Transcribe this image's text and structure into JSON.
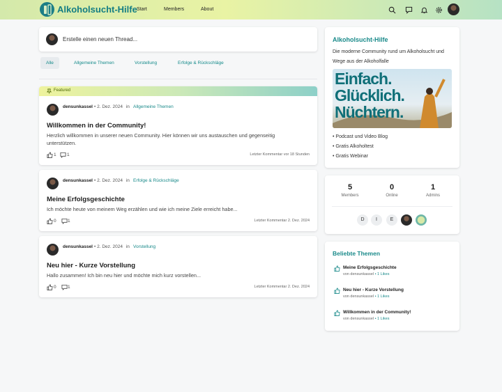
{
  "header": {
    "brand": "Alkoholsucht-Hilfe",
    "nav": [
      "Start",
      "Members",
      "About"
    ],
    "icons": [
      "search-icon",
      "chat-icon",
      "bell-icon",
      "gear-icon",
      "avatar"
    ]
  },
  "composer": {
    "placeholder": "Erstelle einen neuen Thread..."
  },
  "tabs": [
    "Alle",
    "Allgemeine Themen",
    "Vorstellung",
    "Erfolge & Rückschläge"
  ],
  "featured_label": "Featured",
  "posts": [
    {
      "author": "densunkassel",
      "date": "2. Dez. 2024",
      "in": "in",
      "category": "Allgemeine Themen",
      "title": "Willkommen in der Community!",
      "excerpt": "Herzlich willkommen in unserer neuen Community. Hier können wir uns austauschen und gegenseitig unterstützen.",
      "likes": "1",
      "comments": "1",
      "last": "Letzter Kommentar vor 18 Stunden"
    },
    {
      "author": "densunkassel",
      "date": "2. Dez. 2024",
      "in": "in",
      "category": "Erfolge & Rückschläge",
      "title": "Meine Erfolgsgeschichte",
      "excerpt": "Ich möchte heute von meinem Weg erzählen und wie ich meine Ziele erreicht habe...",
      "likes": "0",
      "comments": "1",
      "last": "Letzter Kommentar 2. Dez. 2024"
    },
    {
      "author": "densunkassel",
      "date": "2. Dez. 2024",
      "in": "in",
      "category": "Vorstellung",
      "title": "Neu hier - Kurze Vorstellung",
      "excerpt": "Hallo zusammen! Ich bin neu hier und möchte mich kurz vorstellen...",
      "likes": "0",
      "comments": "1",
      "last": "Letzter Kommentar 2. Dez. 2024"
    }
  ],
  "about": {
    "title": "Alkoholsucht-Hilfe",
    "description": "Die moderne Community rund um Alkoholsucht und Wege aus der Alkoholfalle",
    "banner_text": [
      "Einfach.",
      "Glücklich.",
      "Nüchtern."
    ],
    "links": [
      "Podcast und Video Blog",
      "Gratis Alkoholtest",
      "Gratis Webinar"
    ]
  },
  "stats": [
    {
      "value": "5",
      "label": "Members"
    },
    {
      "value": "0",
      "label": "Online"
    },
    {
      "value": "1",
      "label": "Admins"
    }
  ],
  "member_initials": [
    "D",
    "I",
    "E"
  ],
  "popular": {
    "title": "Beliebte Themen",
    "items": [
      {
        "title": "Meine Erfolgsgeschichte",
        "by": "von densunkassel",
        "likes": "• 1 Likes"
      },
      {
        "title": "Neu hier - Kurze Vorstellung",
        "by": "von densunkassel",
        "likes": "• 1 Likes"
      },
      {
        "title": "Willkommen in der Community!",
        "by": "von densunkassel",
        "likes": "• 1 Likes"
      }
    ]
  },
  "colors": {
    "accent": "#1a8a8a",
    "brand": "#137d83"
  }
}
